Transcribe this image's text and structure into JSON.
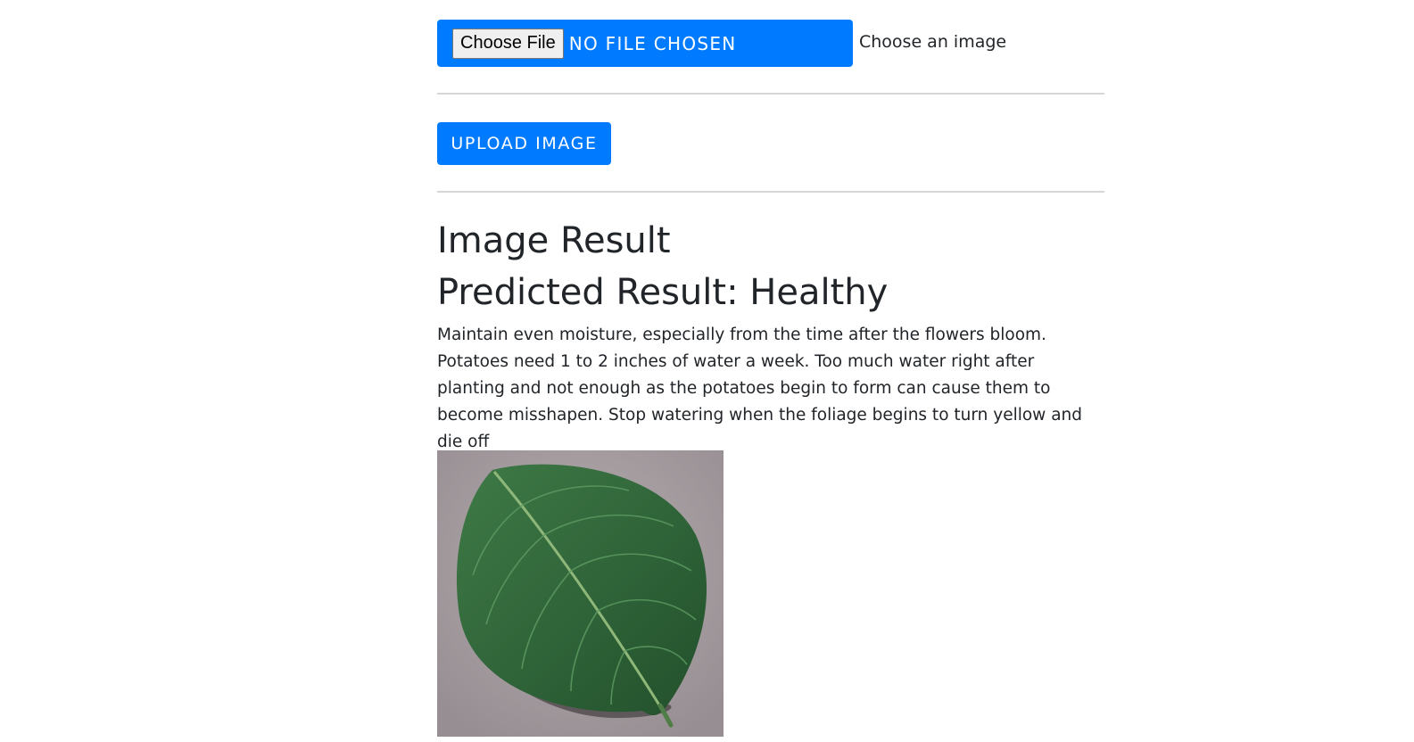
{
  "upload_form": {
    "choose_file_label": "Choose File",
    "file_status": "NO FILE CHOSEN",
    "file_hint": "Choose an image",
    "upload_button_label": "UPLOAD IMAGE"
  },
  "result": {
    "heading": "Image Result",
    "prediction": "Predicted Result: Healthy",
    "advice": "Maintain even moisture, especially from the time after the flowers bloom. Potatoes need 1 to 2 inches of water a week. Too much water right after planting and not enough as the potatoes begin to form can cause them to become misshapen. Stop watering when the foliage begins to turn yellow and die off",
    "image_icon": "potato-leaf-photo"
  },
  "colors": {
    "primary": "#007bff",
    "text": "#212529",
    "divider": "#d6d6d6"
  }
}
